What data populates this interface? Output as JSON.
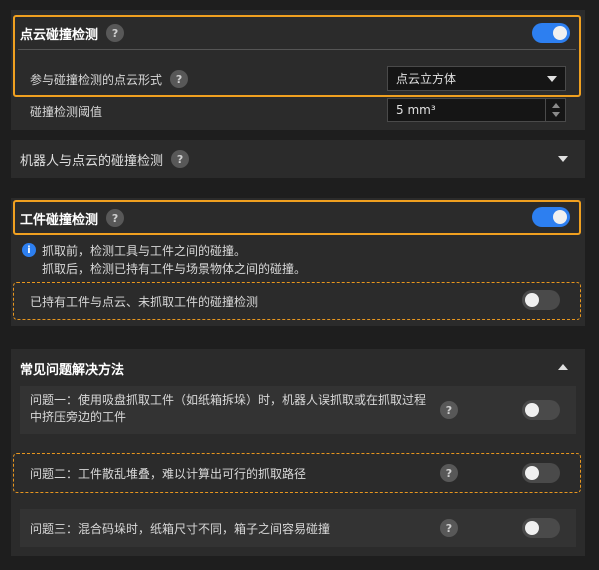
{
  "pointcloud": {
    "title": "点云碰撞检测",
    "help_glyph": "?",
    "enabled": true,
    "form_label": "参与碰撞检测的点云形式",
    "form_value": "点云立方体",
    "threshold_label": "碰撞检测阈值",
    "threshold_value": "5 mm³"
  },
  "robot": {
    "title": "机器人与点云的碰撞检测",
    "help_glyph": "?"
  },
  "workpiece": {
    "title": "工件碰撞检测",
    "help_glyph": "?",
    "enabled": true,
    "info_glyph": "i",
    "info_line1": "抓取前，检测工具与工件之间的碰撞。",
    "info_line2": "抓取后，检测已持有工件与场景物体之间的碰撞。",
    "held_label": "已持有工件与点云、未抓取工件的碰撞检测",
    "held_enabled": false
  },
  "faq": {
    "title": "常见问题解决方法",
    "items": [
      {
        "label_line1": "问题一：使用吸盘抓取工件（如纸箱拆垛）时，机器人误抓取或在抓取过程",
        "label_line2": "中挤压旁边的工件",
        "help_glyph": "?",
        "enabled": false
      },
      {
        "label_line1": "问题二：工件散乱堆叠，难以计算出可行的抓取路径",
        "help_glyph": "?",
        "enabled": false
      },
      {
        "label_line1": "问题三：混合码垛时，纸箱尺寸不同，箱子之间容易碰撞",
        "help_glyph": "?",
        "enabled": false
      }
    ]
  },
  "colors": {
    "accent": "#2d7ff0",
    "highlight": "#f0a020",
    "panel": "#2b2b2b",
    "background": "#1e1e1e"
  }
}
